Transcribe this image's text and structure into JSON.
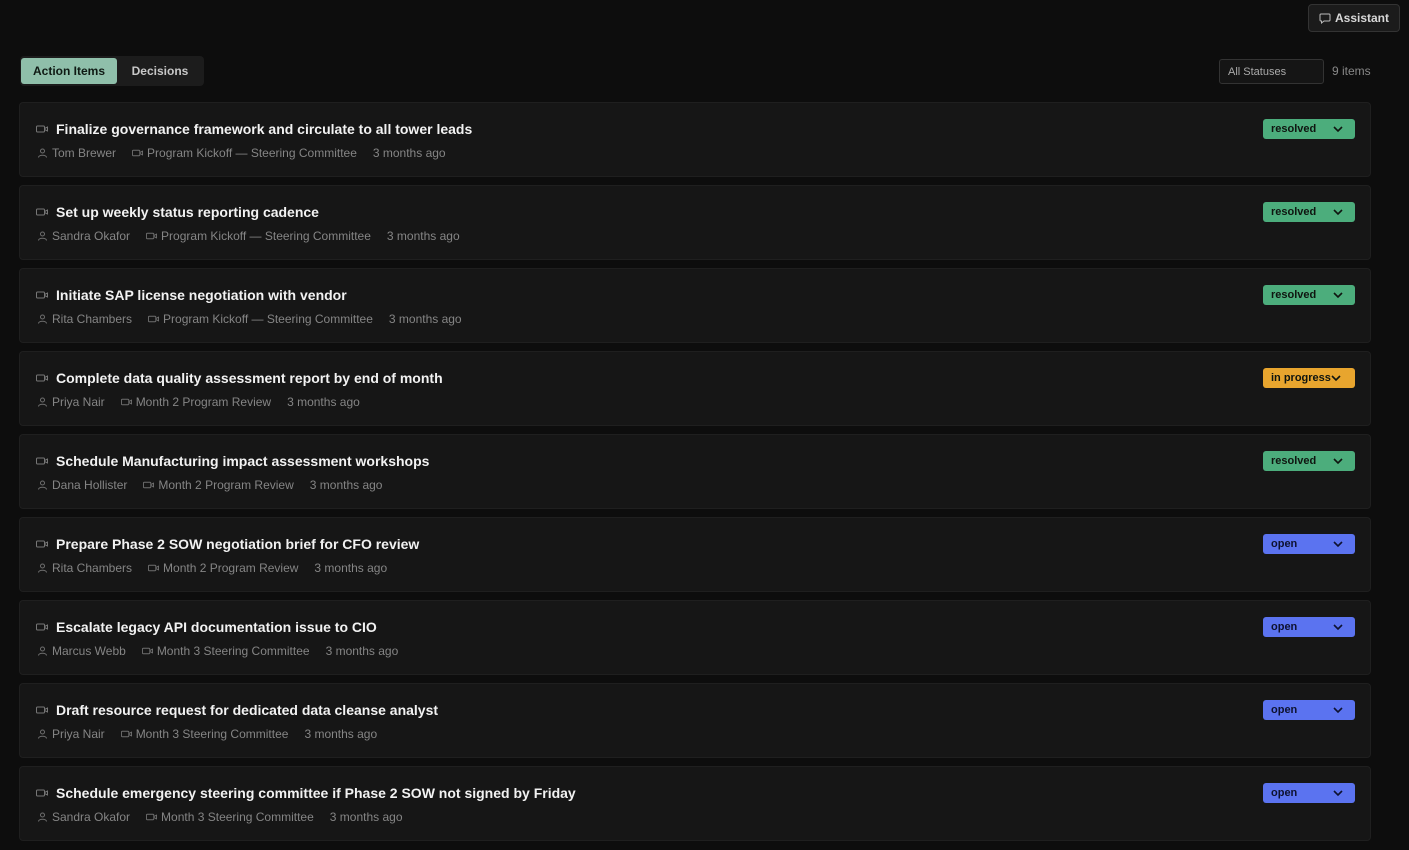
{
  "header": {
    "assistant_label": "Assistant",
    "assistant_icon": "chat-bubble-icon"
  },
  "tabs": [
    {
      "label": "Action Items",
      "active": true
    },
    {
      "label": "Decisions",
      "active": false
    }
  ],
  "filter": {
    "status_selected": "All Statuses",
    "count_label": "9 items"
  },
  "colors": {
    "resolved": "#4cad7c",
    "in_progress": "#e8a52e",
    "open": "#5b73f0",
    "active_tab": "#8fbfaa"
  },
  "items": [
    {
      "title": "Finalize governance framework and circulate to all tower leads",
      "owner": "Tom Brewer",
      "meeting": "Program Kickoff — Steering Committee",
      "time": "3 months ago",
      "status": "resolved"
    },
    {
      "title": "Set up weekly status reporting cadence",
      "owner": "Sandra Okafor",
      "meeting": "Program Kickoff — Steering Committee",
      "time": "3 months ago",
      "status": "resolved"
    },
    {
      "title": "Initiate SAP license negotiation with vendor",
      "owner": "Rita Chambers",
      "meeting": "Program Kickoff — Steering Committee",
      "time": "3 months ago",
      "status": "resolved"
    },
    {
      "title": "Complete data quality assessment report by end of month",
      "owner": "Priya Nair",
      "meeting": "Month 2 Program Review",
      "time": "3 months ago",
      "status": "in progress"
    },
    {
      "title": "Schedule Manufacturing impact assessment workshops",
      "owner": "Dana Hollister",
      "meeting": "Month 2 Program Review",
      "time": "3 months ago",
      "status": "resolved"
    },
    {
      "title": "Prepare Phase 2 SOW negotiation brief for CFO review",
      "owner": "Rita Chambers",
      "meeting": "Month 2 Program Review",
      "time": "3 months ago",
      "status": "open"
    },
    {
      "title": "Escalate legacy API documentation issue to CIO",
      "owner": "Marcus Webb",
      "meeting": "Month 3 Steering Committee",
      "time": "3 months ago",
      "status": "open"
    },
    {
      "title": "Draft resource request for dedicated data cleanse analyst",
      "owner": "Priya Nair",
      "meeting": "Month 3 Steering Committee",
      "time": "3 months ago",
      "status": "open"
    },
    {
      "title": "Schedule emergency steering committee if Phase 2 SOW not signed by Friday",
      "owner": "Sandra Okafor",
      "meeting": "Month 3 Steering Committee",
      "time": "3 months ago",
      "status": "open"
    }
  ]
}
